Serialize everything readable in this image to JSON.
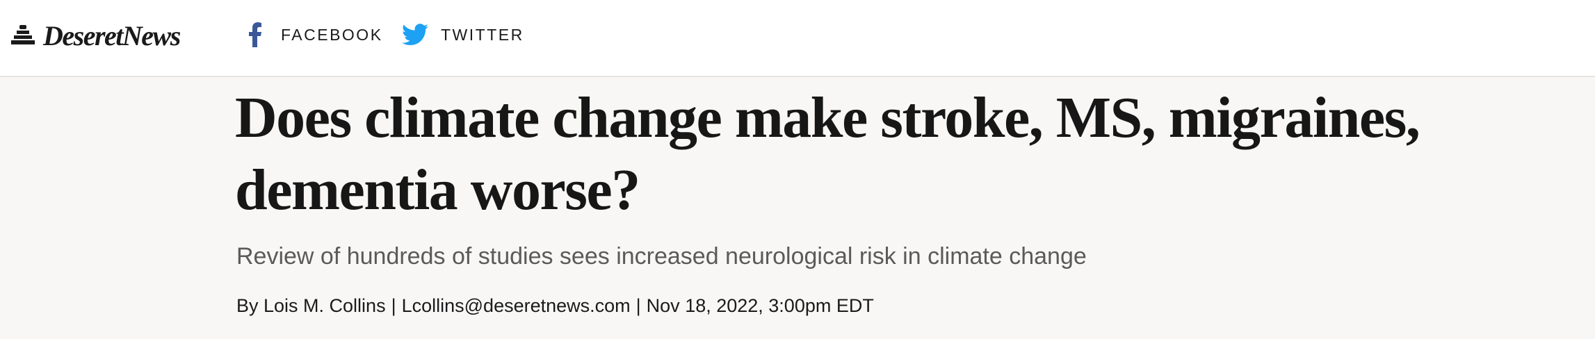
{
  "header": {
    "logo_text": "DeseretNews",
    "share": {
      "facebook_label": "FACEBOOK",
      "twitter_label": "TWITTER"
    }
  },
  "article": {
    "headline": "Does climate change make stroke, MS, migraines, dementia worse?",
    "subhead": "Review of hundreds of studies sees increased neurological risk in climate change",
    "byline": {
      "author": "By Lois M. Collins",
      "sep1": "|",
      "email": "Lcollins@deseretnews.com",
      "sep2": "|",
      "date": "Nov 18, 2022, 3:00pm EDT"
    }
  },
  "colors": {
    "facebook": "#3b5998",
    "twitter": "#1da1f2",
    "page_bg": "#f8f7f5",
    "header_bg": "#ffffff"
  },
  "icons": [
    "beehive-icon",
    "facebook-icon",
    "twitter-icon"
  ]
}
